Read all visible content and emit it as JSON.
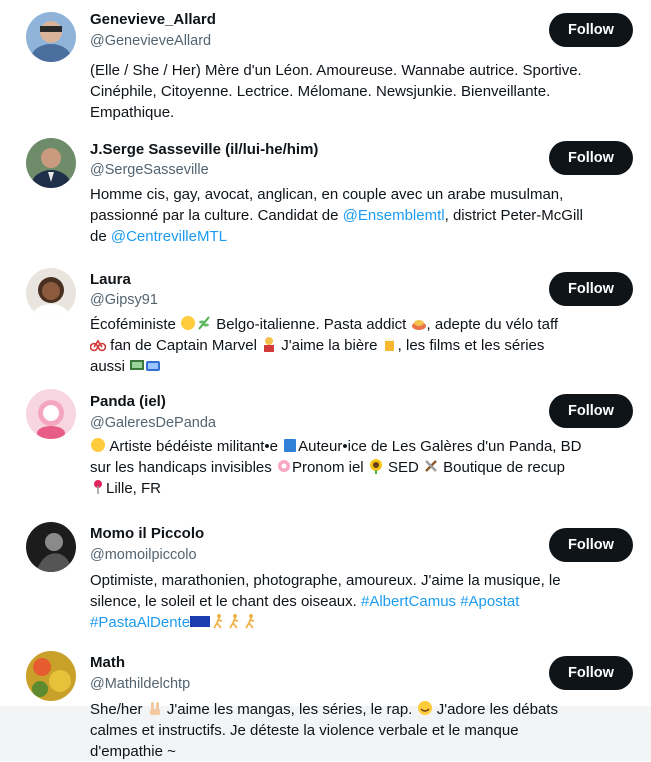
{
  "follow_label": "Follow",
  "colors": {
    "link": "#1d9bf0",
    "button": "#0f1419",
    "handle": "#536471"
  },
  "users": [
    {
      "name": "Genevieve_Allard",
      "handle": "@GenevieveAllard",
      "bio": [
        "(Elle / She / Her) Mère d'un Léon. Amoureuse. Wannabe autrice. Sportive.",
        "Cinéphile, Citoyenne. Lectrice. Mélomane. Newsjunkie. Bienveillante.",
        "Empathique."
      ]
    },
    {
      "name": "J.Serge Sasseville (il/lui-he/him)",
      "handle": "@SergeSasseville",
      "bio": {
        "line1": "Homme cis, gay, avocat, anglican, en couple avec un arabe musulman,",
        "line2_a": "passionné par la culture. Candidat de ",
        "line2_link": "@Ensemblemtl",
        "line2_b": ", district Peter-McGill",
        "line3_a": "de ",
        "line3_link": "@CentrevilleMTL"
      }
    },
    {
      "name": "Laura",
      "handle": "@Gipsy91",
      "bio": {
        "line1_a": "Écoféministe ",
        "line1_b": " Belgo-italienne. Pasta addict ",
        "line1_c": ", adepte du vélo taff",
        "line2_a": " fan de Captain Marvel ",
        "line2_b": " J'aime la bière ",
        "line2_c": ", les films et les séries",
        "line3_a": "aussi "
      }
    },
    {
      "name": "Panda (iel)",
      "handle": "@GaleresDePanda",
      "bio": {
        "line1_a": " Artiste bédéiste militant•e ",
        "line1_b": "Auteur•ice de Les Galères d'un Panda, BD",
        "line2_a": "sur les handicaps invisibles ",
        "line2_b": "Pronom iel ",
        "line2_c": " SED ",
        "line2_d": " Boutique de recup",
        "line3_a": "Lille, FR"
      }
    },
    {
      "name": "Momo il Piccolo",
      "handle": "@momoilpiccolo",
      "bio": {
        "line1": "Optimiste, marathonien, photographe, amoureux. J'aime la musique, le",
        "line2_a": "silence, le soleil et le chant des oiseaux. ",
        "line2_link": "#AlbertCamus #Apostat",
        "line3_link": "#PastaAlDente"
      }
    },
    {
      "name": "Math",
      "handle": "@Mathildelchtp",
      "bio": {
        "line1_a": "She/her ",
        "line1_b": " J'aime les mangas, les séries, le rap. ",
        "line1_c": " J'adore les débats",
        "line2": "calmes et instructifs. Je déteste la violence verbale et le manque",
        "line3": "d'empathie ~"
      }
    }
  ]
}
